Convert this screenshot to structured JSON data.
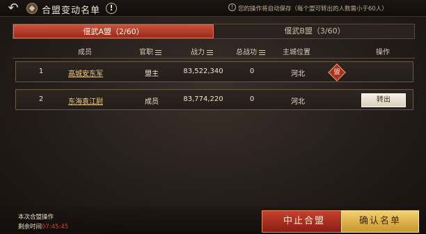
{
  "header": {
    "title": "合盟变动名单",
    "info_glyph": "!",
    "notice": "您的操作将自动保存（每个盟可转出的人数需小于60人）"
  },
  "tabs": [
    {
      "label": "偃武A盟（2/60）",
      "active": true
    },
    {
      "label": "偃武B盟（3/60）",
      "active": false
    }
  ],
  "columns": {
    "member": "成员",
    "rank": "官职",
    "power": "战力",
    "total_merit": "总战功",
    "city": "主城位置",
    "action": "操作"
  },
  "rows": [
    {
      "index": "1",
      "name": "高城安东军",
      "rank": "盟主",
      "power": "83,522,340",
      "merit": "0",
      "city": "河北",
      "badge": "盟"
    },
    {
      "index": "2",
      "name": "东海袁江尉",
      "rank": "成员",
      "power": "83,774,220",
      "merit": "0",
      "city": "河北",
      "action": "转出"
    }
  ],
  "footer": {
    "op_label": "本次合盟操作",
    "time_label": "剩余时间",
    "time_value": "07:45:45",
    "stop_button": "中止合盟",
    "confirm_button": "确认名单"
  },
  "colors": {
    "active_tab": "#c8503a",
    "name_link": "#f0d080",
    "timer": "#e04030",
    "stop_button": "#b03020",
    "confirm_button": "#e0b050"
  },
  "icons": [
    "back-arrow-icon",
    "alliance-emblem-icon",
    "info-icon",
    "notice-icon",
    "sort-icon",
    "leader-badge-icon"
  ]
}
